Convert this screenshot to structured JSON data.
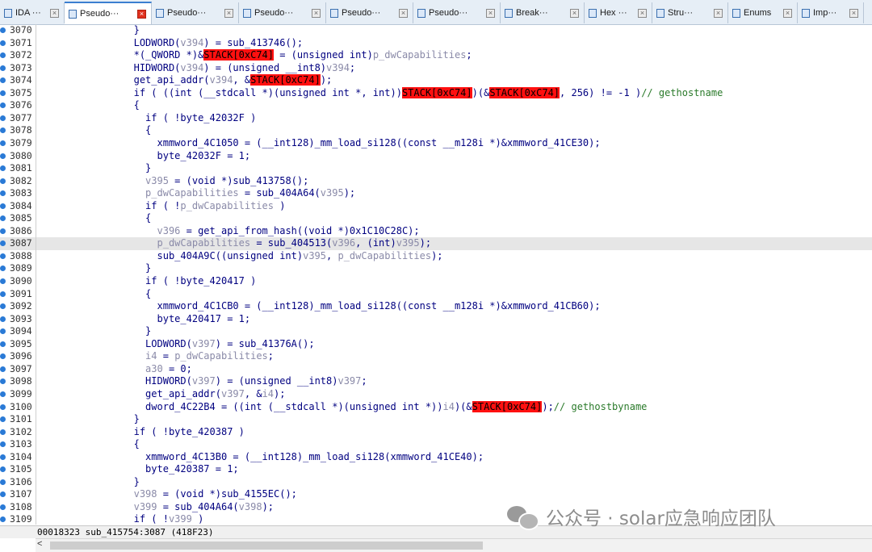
{
  "tabs": [
    {
      "label": "IDA ···",
      "active": false
    },
    {
      "label": "Pseudo···",
      "active": true
    },
    {
      "label": "Pseudo···",
      "active": false
    },
    {
      "label": "Pseudo···",
      "active": false
    },
    {
      "label": "Pseudo···",
      "active": false
    },
    {
      "label": "Pseudo···",
      "active": false
    },
    {
      "label": "Break···",
      "active": false
    },
    {
      "label": "Hex ···",
      "active": false
    },
    {
      "label": "Stru···",
      "active": false
    },
    {
      "label": "Enums",
      "active": false
    },
    {
      "label": "Imp···",
      "active": false
    }
  ],
  "lines": [
    {
      "n": "3070",
      "code": [
        {
          "t": "                }"
        }
      ]
    },
    {
      "n": "3071",
      "code": [
        {
          "t": "                LODWORD("
        },
        {
          "t": "v394",
          "c": "g"
        },
        {
          "t": ") = sub_413746();"
        }
      ]
    },
    {
      "n": "3072",
      "code": [
        {
          "t": "                *(_QWORD *)&"
        },
        {
          "t": "STACK[0xC74]",
          "c": "r"
        },
        {
          "t": " = (unsigned int)"
        },
        {
          "t": "p_dwCapabilities",
          "c": "g"
        },
        {
          "t": ";"
        }
      ]
    },
    {
      "n": "3073",
      "code": [
        {
          "t": "                HIDWORD("
        },
        {
          "t": "v394",
          "c": "g"
        },
        {
          "t": ") = (unsigned __int8)"
        },
        {
          "t": "v394",
          "c": "g"
        },
        {
          "t": ";"
        }
      ]
    },
    {
      "n": "3074",
      "code": [
        {
          "t": "                get_api_addr("
        },
        {
          "t": "v394",
          "c": "g"
        },
        {
          "t": ", &"
        },
        {
          "t": "STACK[0xC74]",
          "c": "r"
        },
        {
          "t": ");"
        }
      ]
    },
    {
      "n": "3075",
      "code": [
        {
          "t": "                if ( ((int (__stdcall *)(unsigned int *, int))"
        },
        {
          "t": "STACK[0xC74]",
          "c": "r"
        },
        {
          "t": ")(&"
        },
        {
          "t": "STACK[0xC74]",
          "c": "r"
        },
        {
          "t": ", 256) != -1 )"
        },
        {
          "t": "// gethostname",
          "c": "c"
        }
      ]
    },
    {
      "n": "3076",
      "code": [
        {
          "t": "                {"
        }
      ]
    },
    {
      "n": "3077",
      "code": [
        {
          "t": "                  if ( !byte_42032F )"
        }
      ]
    },
    {
      "n": "3078",
      "code": [
        {
          "t": "                  {"
        }
      ]
    },
    {
      "n": "3079",
      "code": [
        {
          "t": "                    xmmword_4C1050 = (__int128)_mm_load_si128((const __m128i *)&xmmword_41CE30);"
        }
      ]
    },
    {
      "n": "3080",
      "code": [
        {
          "t": "                    byte_42032F = 1;"
        }
      ]
    },
    {
      "n": "3081",
      "code": [
        {
          "t": "                  }"
        }
      ]
    },
    {
      "n": "3082",
      "code": [
        {
          "t": "v395",
          "c": "g",
          "pre": "                  "
        },
        {
          "t": " = (void *)sub_413758();"
        }
      ]
    },
    {
      "n": "3083",
      "code": [
        {
          "t": "p_dwCapabilities",
          "c": "g",
          "pre": "                  "
        },
        {
          "t": " = sub_404A64("
        },
        {
          "t": "v395",
          "c": "g"
        },
        {
          "t": ");"
        }
      ]
    },
    {
      "n": "3084",
      "code": [
        {
          "t": "                  if ( !"
        },
        {
          "t": "p_dwCapabilities",
          "c": "g"
        },
        {
          "t": " )"
        }
      ]
    },
    {
      "n": "3085",
      "code": [
        {
          "t": "                  {"
        }
      ]
    },
    {
      "n": "3086",
      "code": [
        {
          "t": "v396",
          "c": "g",
          "pre": "                    "
        },
        {
          "t": " = get_api_from_hash((void *)0x1C10C28C);"
        }
      ]
    },
    {
      "n": "3087",
      "hl": true,
      "code": [
        {
          "t": "p_dwCapabilities",
          "c": "g",
          "pre": "                    "
        },
        {
          "t": " = sub_404513("
        },
        {
          "t": "v396",
          "c": "g"
        },
        {
          "t": ", (int)"
        },
        {
          "t": "v395",
          "c": "g"
        },
        {
          "t": ");"
        }
      ]
    },
    {
      "n": "3088",
      "code": [
        {
          "t": "                    sub_404A9C((unsigned int)"
        },
        {
          "t": "v395",
          "c": "g"
        },
        {
          "t": ", "
        },
        {
          "t": "p_dwCapabilities",
          "c": "g"
        },
        {
          "t": ");"
        }
      ]
    },
    {
      "n": "3089",
      "code": [
        {
          "t": "                  }"
        }
      ]
    },
    {
      "n": "3090",
      "code": [
        {
          "t": "                  if ( !byte_420417 )"
        }
      ]
    },
    {
      "n": "3091",
      "code": [
        {
          "t": "                  {"
        }
      ]
    },
    {
      "n": "3092",
      "code": [
        {
          "t": "                    xmmword_4C1CB0 = (__int128)_mm_load_si128((const __m128i *)&xmmword_41CB60);"
        }
      ]
    },
    {
      "n": "3093",
      "code": [
        {
          "t": "                    byte_420417 = 1;"
        }
      ]
    },
    {
      "n": "3094",
      "code": [
        {
          "t": "                  }"
        }
      ]
    },
    {
      "n": "3095",
      "code": [
        {
          "t": "                  LODWORD("
        },
        {
          "t": "v397",
          "c": "g"
        },
        {
          "t": ") = sub_41376A();"
        }
      ]
    },
    {
      "n": "3096",
      "code": [
        {
          "t": "i4",
          "c": "g",
          "pre": "                  "
        },
        {
          "t": " = "
        },
        {
          "t": "p_dwCapabilities",
          "c": "g"
        },
        {
          "t": ";"
        }
      ]
    },
    {
      "n": "3097",
      "code": [
        {
          "t": "a30",
          "c": "g",
          "pre": "                  "
        },
        {
          "t": " = 0;"
        }
      ]
    },
    {
      "n": "3098",
      "code": [
        {
          "t": "                  HIDWORD("
        },
        {
          "t": "v397",
          "c": "g"
        },
        {
          "t": ") = (unsigned __int8)"
        },
        {
          "t": "v397",
          "c": "g"
        },
        {
          "t": ";"
        }
      ]
    },
    {
      "n": "3099",
      "code": [
        {
          "t": "                  get_api_addr("
        },
        {
          "t": "v397",
          "c": "g"
        },
        {
          "t": ", &"
        },
        {
          "t": "i4",
          "c": "g"
        },
        {
          "t": ");"
        }
      ]
    },
    {
      "n": "3100",
      "code": [
        {
          "t": "                  dword_4C22B4 = ((int (__stdcall *)(unsigned int *))"
        },
        {
          "t": "i4",
          "c": "g"
        },
        {
          "t": ")(&"
        },
        {
          "t": "STACK[0xC74]",
          "c": "r"
        },
        {
          "t": ");"
        },
        {
          "t": "// gethostbyname",
          "c": "c"
        }
      ]
    },
    {
      "n": "3101",
      "code": [
        {
          "t": "                }"
        }
      ]
    },
    {
      "n": "3102",
      "code": [
        {
          "t": "                if ( !byte_420387 )"
        }
      ]
    },
    {
      "n": "3103",
      "code": [
        {
          "t": "                {"
        }
      ]
    },
    {
      "n": "3104",
      "code": [
        {
          "t": "                  xmmword_4C13B0 = (__int128)_mm_load_si128(xmmword_41CE40);"
        }
      ]
    },
    {
      "n": "3105",
      "code": [
        {
          "t": "                  byte_420387 = 1;"
        }
      ]
    },
    {
      "n": "3106",
      "code": [
        {
          "t": "                }"
        }
      ]
    },
    {
      "n": "3107",
      "code": [
        {
          "t": "v398",
          "c": "g",
          "pre": "                "
        },
        {
          "t": " = (void *)sub_4155EC();"
        }
      ]
    },
    {
      "n": "3108",
      "code": [
        {
          "t": "v399",
          "c": "g",
          "pre": "                "
        },
        {
          "t": " = sub_404A64("
        },
        {
          "t": "v398",
          "c": "g"
        },
        {
          "t": ");"
        }
      ]
    },
    {
      "n": "3109",
      "code": [
        {
          "t": "                if ( !"
        },
        {
          "t": "v399",
          "c": "g"
        },
        {
          "t": " )"
        }
      ]
    }
  ],
  "status": "00018323 sub_415754:3087 (418F23)",
  "scroll_arrow": "<",
  "watermark": "公众号 · solar应急响应团队"
}
